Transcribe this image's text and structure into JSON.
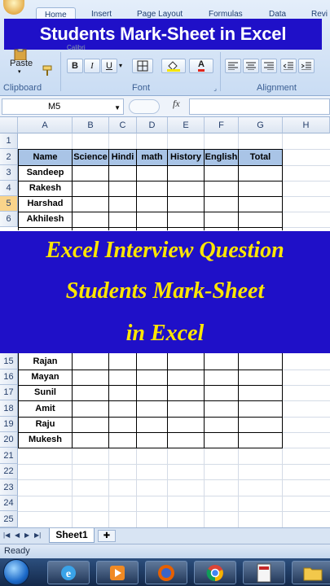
{
  "ribbon": {
    "tabs": [
      "Home",
      "Insert",
      "Page Layout",
      "Formulas",
      "Data",
      "Revi"
    ],
    "font_name_partial": "Calibri",
    "groups": {
      "clipboard": "Clipboard",
      "font": "Font",
      "alignment": "Alignment"
    },
    "paste_label": "Paste",
    "bold": "B",
    "italic": "I",
    "underline": "U",
    "font_color_letter": "A",
    "banner_title": "Students Mark-Sheet in Excel"
  },
  "formula_bar": {
    "name_box": "M5",
    "fx": "fx",
    "content": ""
  },
  "sheet": {
    "columns": [
      "A",
      "B",
      "C",
      "D",
      "E",
      "F",
      "G",
      "H"
    ],
    "rows_top": [
      "1",
      "2",
      "3",
      "4",
      "5",
      "6"
    ],
    "rows_bottom": [
      "15",
      "16",
      "17",
      "18",
      "19",
      "20",
      "21",
      "22",
      "23",
      "24",
      "25"
    ],
    "selected_row": "5",
    "headers": [
      "Name",
      "Science",
      "Hindi",
      "math",
      "History",
      "English",
      "Total"
    ],
    "names_top": [
      "Sandeep",
      "Rakesh",
      "Harshad",
      "Akhilesh"
    ],
    "names_bottom": [
      "Rajan",
      "Mayan",
      "Sunil",
      "Amit",
      "Raju",
      "Mukesh"
    ]
  },
  "overlay": {
    "line1": "Excel Interview Question",
    "line2": "Students Mark-Sheet",
    "line3": "in Excel"
  },
  "sheet_tab": "Sheet1",
  "status": "Ready",
  "colors": {
    "banner": "#1f10c8",
    "overlay_text": "#ffe600",
    "header_fill": "#a9c4e6"
  },
  "taskbar": [
    "start-orb",
    "internet-explorer",
    "media-player",
    "firefox",
    "chrome",
    "tally-erp9",
    "folder"
  ]
}
